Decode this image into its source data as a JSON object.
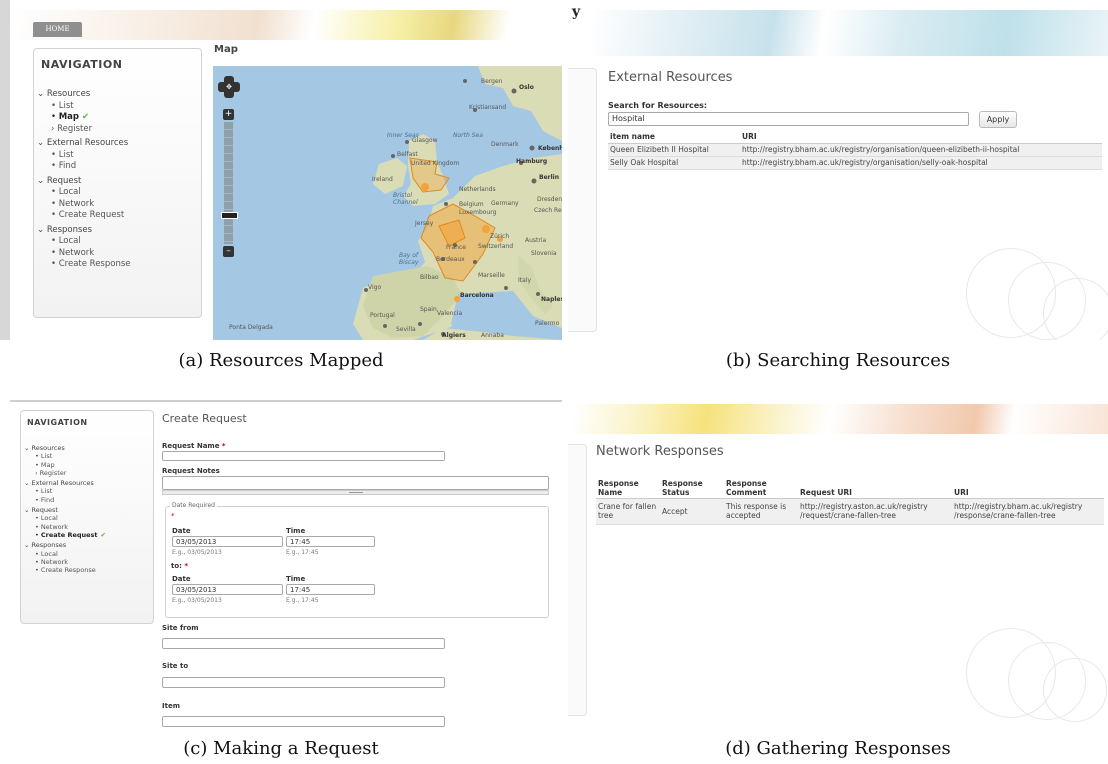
{
  "captions": {
    "a": "(a) Resources Mapped",
    "b": "(b) Searching Resources",
    "c": "(c) Making a Request",
    "d": "(d) Gathering Responses"
  },
  "panel_a": {
    "home_tab": "HOME",
    "nav_title": "NAVIGATION",
    "map_heading": "Map",
    "check_glyph": "✔",
    "nav": [
      {
        "label": "Resources",
        "items": [
          "List",
          "Map",
          "Register"
        ]
      },
      {
        "label": "External Resources",
        "items": [
          "List",
          "Find"
        ]
      },
      {
        "label": "Request",
        "items": [
          "Local",
          "Network",
          "Create Request"
        ]
      },
      {
        "label": "Responses",
        "items": [
          "Local",
          "Network",
          "Create Response"
        ]
      }
    ],
    "zoom_in": "+",
    "zoom_out": "–",
    "map_labels": {
      "bergen": "Bergen",
      "oslo": "Oslo",
      "kristiansand": "Kristiansand",
      "inner_seas": "Inner Seas",
      "glasgow": "Glasgow",
      "north_sea": "North Sea",
      "denmark": "Denmark",
      "kobenhavn": "København",
      "belfast": "Belfast",
      "united_kingdom": "United Kingdom",
      "hamburg": "Hamburg",
      "ireland": "Ireland",
      "berlin": "Berlin",
      "netherlands": "Netherlands",
      "bristol_channel": "Bristol Channel",
      "belgium": "Belgium",
      "germany": "Germany",
      "dresden": "Dresden",
      "luxembourg": "Luxembourg",
      "czech_rep": "Czech Rep.",
      "jersey": "Jersey",
      "zurich": "Zürich",
      "austria": "Austria",
      "france": "France",
      "switzerland": "Switzerland",
      "slovenia": "Slovenia",
      "bay_of_biscay": "Bay of Biscay",
      "bordeaux": "Bordeaux",
      "bilbao": "Bilbao",
      "marseille": "Marseille",
      "italy": "Italy",
      "vigo": "Vigo",
      "barcelona": "Barcelona",
      "naples": "Naples",
      "spain": "Spain",
      "valencia": "Valencia",
      "portugal": "Portugal",
      "palermo": "Palermo",
      "ponta_delgada": "Ponta Delgada",
      "sevilla": "Sevilla",
      "algiers": "Algiers",
      "annaba": "Annaba"
    }
  },
  "panel_b": {
    "heading": "External Resources",
    "search_label": "Search for Resources:",
    "search_value": "Hospital",
    "apply_button": "Apply",
    "columns": [
      "item name",
      "URI"
    ],
    "rows": [
      {
        "name": "Queen Elizibeth II Hospital",
        "uri": "http://registry.bham.ac.uk/registry/organisation/queen-elizibeth-ii-hospital"
      },
      {
        "name": "Selly Oak Hospital",
        "uri": "http://registry.bham.ac.uk/registry/organisation/selly-oak-hospital"
      }
    ]
  },
  "panel_c": {
    "nav_title": "NAVIGATION",
    "heading": "Create Request",
    "request_name_label": "Request Name",
    "required_mark": "*",
    "request_notes_label": "Request Notes",
    "date_required_legend": "Date Required",
    "date_label": "Date",
    "time_label": "Time",
    "date_value": "03/05/2013",
    "time_value": "17:45",
    "date_hint": "E.g., 03/05/2013",
    "time_hint": "E.g., 17:45",
    "to_label": "to:",
    "site_from_label": "Site from",
    "site_to_label": "Site to",
    "item_label": "Item"
  },
  "panel_d": {
    "heading": "Network Responses",
    "columns": [
      "Response Name",
      "Response Status",
      "Response Comment",
      "Request URI",
      "URI"
    ],
    "rows": [
      {
        "name": "Crane for fallen tree",
        "status": "Accept",
        "comment": "This response is accepted",
        "request_uri": "http://registry.aston.ac.uk/registry /request/crane-fallen-tree",
        "uri": "http://registry.bham.ac.uk/registry /response/crane-fallen-tree"
      }
    ]
  },
  "colors": {
    "accent_green": "#5fb332",
    "map_sea": "#a4c8e4",
    "map_land": "#d9dcb4",
    "polygon_orange": "#f3a33a",
    "required_red": "#cc0000"
  }
}
